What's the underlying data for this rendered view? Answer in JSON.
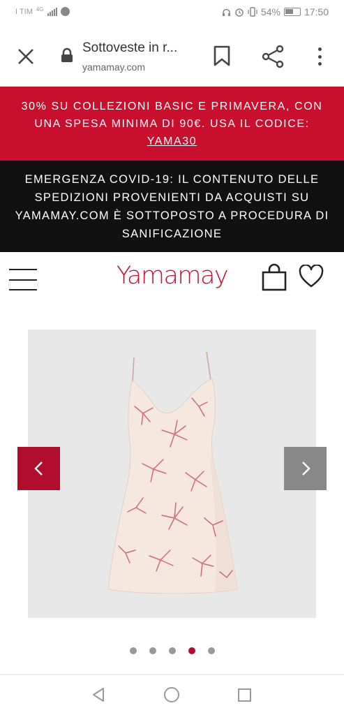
{
  "status_bar": {
    "carrier": "I TIM",
    "network": "4G",
    "battery_percent": "54%",
    "time": "17:50"
  },
  "browser": {
    "page_title": "Sottoveste in r...",
    "url": "yamamay.com"
  },
  "promo_banner": {
    "text": "30% SU COLLEZIONI BASIC E PRIMAVERA, CON UNA SPESA MINIMA DI 90€. USA IL CODICE: ",
    "code": "YAMA30",
    "background": "#c8102e"
  },
  "covid_banner": {
    "text": "EMERGENZA COVID-19: IL CONTENUTO DELLE SPEDIZIONI PROVENIENTI DA ACQUISTI SU YAMAMAY.COM È SOTTOPOSTO A PROCEDURA DI SANIFICAZIONE",
    "background": "#111111"
  },
  "header": {
    "logo": "Yamamay",
    "brand_color": "#c8102e"
  },
  "gallery": {
    "current_slide": 4,
    "total_slides": 5,
    "prev_arrow": "chevron-left-icon",
    "next_arrow": "chevron-right-icon"
  }
}
